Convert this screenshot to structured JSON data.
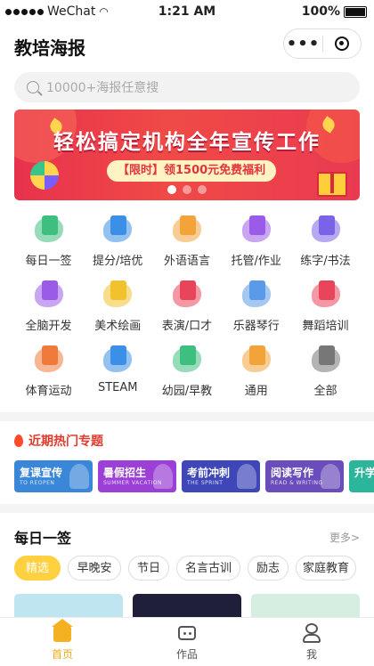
{
  "status": {
    "carrier": "WeChat",
    "time": "1:21 AM",
    "battery": "100%"
  },
  "nav": {
    "title": "教培海报",
    "more_icon": "more-dots-icon",
    "close_icon": "target-icon"
  },
  "search": {
    "placeholder": "10000+海报任意搜"
  },
  "banner": {
    "headline": "轻松搞定机构全年宣传工作",
    "promo": "【限时】领1500元免费福利",
    "slides": 3,
    "active_slide": 1
  },
  "categories": [
    {
      "label": "每日一签",
      "icon": "calendar-icon",
      "color": "#3fbf7f"
    },
    {
      "label": "提分/培优",
      "icon": "graduation-cap-icon",
      "color": "#3b8fe6"
    },
    {
      "label": "外语语言",
      "icon": "books-icon",
      "color": "#f2a33a"
    },
    {
      "label": "托管/作业",
      "icon": "homework-icon",
      "color": "#9a5ce8"
    },
    {
      "label": "练字/书法",
      "icon": "pen-icon",
      "color": "#7a63e6"
    },
    {
      "label": "全脑开发",
      "icon": "brain-icon",
      "color": "#9a5ce8"
    },
    {
      "label": "美术绘画",
      "icon": "palette-icon",
      "color": "#f2c12e"
    },
    {
      "label": "表演/口才",
      "icon": "microphone-icon",
      "color": "#e8455b"
    },
    {
      "label": "乐器琴行",
      "icon": "piano-icon",
      "color": "#5b9ae8"
    },
    {
      "label": "舞蹈培训",
      "icon": "ballet-shoes-icon",
      "color": "#e8455b"
    },
    {
      "label": "体育运动",
      "icon": "sport-icon",
      "color": "#f07a3c"
    },
    {
      "label": "STEAM",
      "icon": "robot-icon",
      "color": "#3b8fe6"
    },
    {
      "label": "幼园/早教",
      "icon": "sprout-icon",
      "color": "#3fbf7f"
    },
    {
      "label": "通用",
      "icon": "star-icon",
      "color": "#f2a33a"
    },
    {
      "label": "全部",
      "icon": "all-grid-icon",
      "color": "#777777"
    }
  ],
  "hot": {
    "title": "近期热门专题",
    "topics": [
      {
        "title": "复课宣传",
        "subtitle": "TO REOPEN",
        "color": "#3a86d8"
      },
      {
        "title": "暑假招生",
        "subtitle": "SUMMER VACATION",
        "color": "#9b3fd6"
      },
      {
        "title": "考前冲刺",
        "subtitle": "THE SPRINT",
        "color": "#3f47b8"
      },
      {
        "title": "阅读写作",
        "subtitle": "READ & WRITING",
        "color": "#6a4dbb"
      },
      {
        "title": "升学",
        "subtitle": "",
        "color": "#2bb59a"
      }
    ]
  },
  "daily": {
    "title": "每日一签",
    "more": "更多>",
    "tags": [
      "精选",
      "早晚安",
      "节日",
      "名言古训",
      "励志",
      "家庭教育"
    ],
    "active_tag": 0
  },
  "tabbar": {
    "items": [
      {
        "label": "首页",
        "icon": "home-icon"
      },
      {
        "label": "作品",
        "icon": "works-icon"
      },
      {
        "label": "我",
        "icon": "profile-icon"
      }
    ],
    "active": 0
  }
}
